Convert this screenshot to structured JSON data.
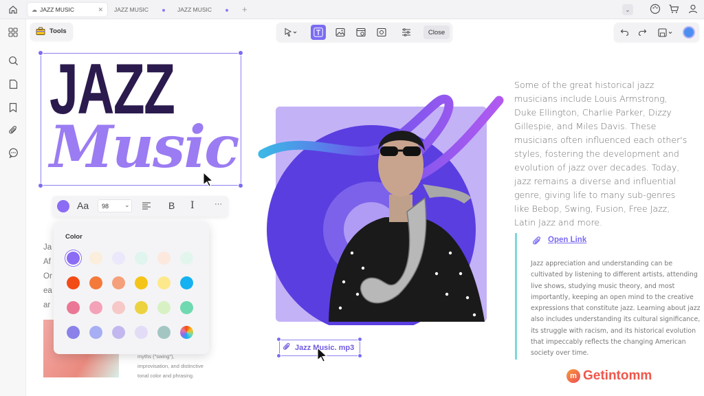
{
  "tabs": [
    {
      "label": "JAZZ MUSIC",
      "active": true
    },
    {
      "label": "JAZZ MUSIC",
      "active": false
    },
    {
      "label": "JAZZ MUSIC",
      "active": false
    }
  ],
  "toolbar": {
    "tools_label": "Tools",
    "close_label": "Close"
  },
  "title": {
    "line1": "JAZZ",
    "line2": "Music"
  },
  "format_bar": {
    "font_icon": "Aa",
    "font_size": "98",
    "bold": "B",
    "italic": "I",
    "more": "···"
  },
  "color_panel": {
    "label": "Color",
    "swatches": [
      "#8b6cf4",
      "#fbeedd",
      "#ece8fb",
      "#dff5ee",
      "#fde8de",
      "#e3f6ee",
      "#f34b15",
      "#f37a3a",
      "#f5a07a",
      "#f5c419",
      "#fde98c",
      "#16b1f0",
      "#ea7795",
      "#f4a2b8",
      "#f7c8c8",
      "#ecd23f",
      "#d7f1c4",
      "#6fd9b1",
      "#8a82e8",
      "#a7aef3",
      "#c2b8ef",
      "#e3dcf7",
      "#a3c6c3",
      "#conic"
    ]
  },
  "left_partial_text": [
    "Ja",
    "Af",
    "Or",
    "ea",
    "ar"
  ],
  "left_partial_bottom": [
    "myths (\"swing\"),",
    "improvisation, and distinctive",
    "tonal color and phrasing."
  ],
  "right_text": "Some of the great historical jazz musicians include Louis Armstrong, Duke Ellington, Charlie Parker, Dizzy Gillespie, and Miles Davis. These musicians often influenced each other's styles, fostering the development and evolution of jazz over decades. Today, jazz remains a diverse and influential genre, giving life to many sub-genres like Bebop, Swing, Fusion, Free Jazz, Latin Jazz and more.",
  "open_link": "Open Link",
  "quote_text": "Jazz appreciation and understanding can be cultivated by listening to different artists, attending live shows, studying music theory, and most importantly, keeping an open mind to the creative expressions that constitute jazz. Learning about jazz also includes understanding its cultural significance, its struggle with racism, and its historical evolution that impeccably reflects the changing American society over time.",
  "attachment": "Jazz Music. mp3",
  "watermark": "Getintomm",
  "colors": {
    "accent": "#7b6cf2",
    "title_dark": "#2b1a4d",
    "title_light": "#9b7cf2",
    "photo_bg": "#c4b2f7",
    "disc": "#5a3ee0"
  }
}
